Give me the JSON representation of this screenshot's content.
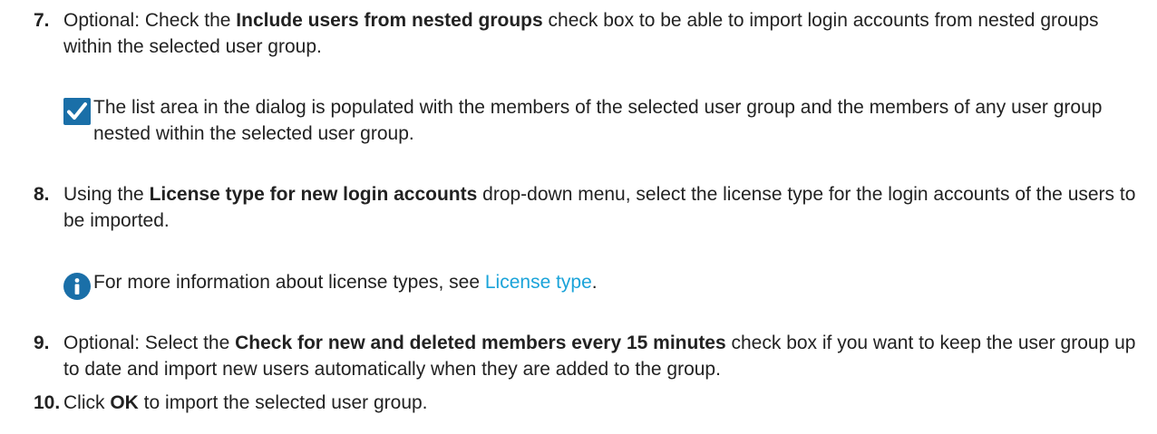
{
  "steps": [
    {
      "number": "7.",
      "prefix": "Optional: Check the ",
      "bold": "Include users from nested groups",
      "suffix": " check box to be able to import login accounts from nested groups within the selected user group."
    },
    {
      "number": "8.",
      "prefix": "Using the ",
      "bold": "License type for new login accounts",
      "suffix": " drop-down menu, select the license type for the login accounts of the users to be imported."
    },
    {
      "number": "9.",
      "prefix": "Optional: Select the ",
      "bold": "Check for new and deleted members every 15 minutes",
      "suffix": " check box if you want to keep the user group up to date and import new users automatically when they are added to the group."
    },
    {
      "number": "10.",
      "prefix": "Click ",
      "bold": "OK",
      "suffix": " to import the selected user group."
    }
  ],
  "notes": {
    "result": {
      "icon": "checkmark-icon",
      "text": "The list area in the dialog is populated with the members of the selected user group and the members of any user group nested within the selected user group."
    },
    "info": {
      "icon": "info-icon",
      "prefix": "For more information about license types, see ",
      "link_text": "License type",
      "suffix": "."
    }
  },
  "colors": {
    "icon_blue": "#1a6fa8",
    "link": "#1aa3d9"
  }
}
